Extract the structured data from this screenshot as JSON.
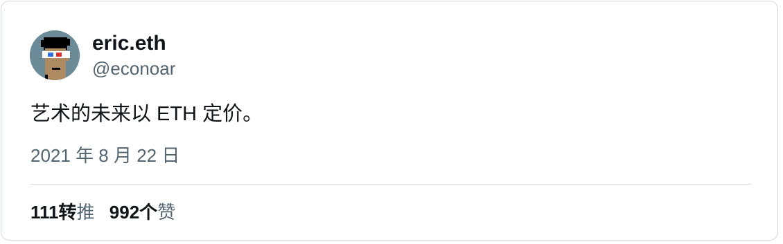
{
  "user": {
    "display_name": "eric.eth",
    "handle": "@econoar"
  },
  "tweet": {
    "text": "艺术的未来以 ETH 定价。",
    "date": "2021 年 8 月 22 日"
  },
  "stats": {
    "retweets_count": "111",
    "retweets_label_bold": "转",
    "retweets_label": "推",
    "likes_count": "992",
    "likes_label_bold": "个",
    "likes_label": "赞"
  },
  "colors": {
    "text_primary": "#0f1419",
    "text_secondary": "#536471",
    "border": "#cfd9de",
    "avatar_bg": "#6c8b99"
  },
  "icons": {
    "avatar": "cryptopunk-3d-glasses-avatar"
  }
}
